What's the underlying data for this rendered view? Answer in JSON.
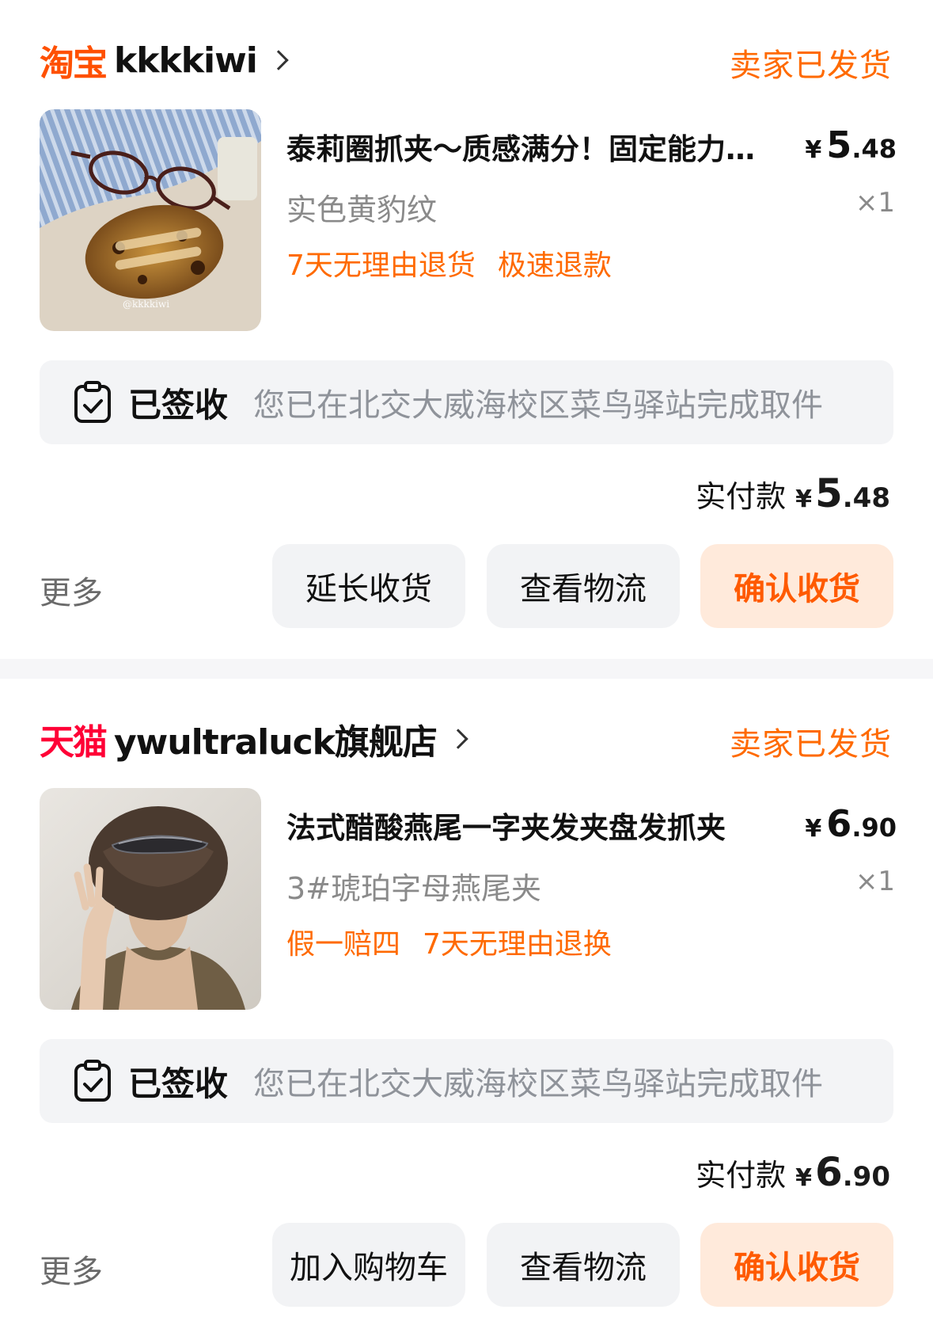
{
  "orders": [
    {
      "platform": "淘宝",
      "shop_name": "kkkkiwi",
      "status": "卖家已发货",
      "product": {
        "title": "泰莉圈抓夹～质感满分！固定能力超强",
        "price_currency": "¥",
        "price_int": "5",
        "price_dec": ".48",
        "sku": "实色黄豹纹",
        "qty": "×1",
        "tags": [
          "7天无理由退货",
          "极速退款"
        ],
        "image_watermark": "@kkkkiwi"
      },
      "logistics": {
        "state": "已签收",
        "detail": "您已在北交大威海校区菜鸟驿站完成取件"
      },
      "paid": {
        "label": "实付款",
        "currency": "¥",
        "int": "5",
        "dec": ".48"
      },
      "more_label": "更多",
      "buttons": [
        "延长收货",
        "查看物流",
        "确认收货"
      ]
    },
    {
      "platform": "天猫",
      "shop_name": "ywultraluck旗舰店",
      "status": "卖家已发货",
      "product": {
        "title": "法式醋酸燕尾一字夹发夹盘发抓夹",
        "price_currency": "¥",
        "price_int": "6",
        "price_dec": ".90",
        "sku": "3#琥珀字母燕尾夹",
        "qty": "×1",
        "tags": [
          "假一赔四",
          "7天无理由退换"
        ]
      },
      "logistics": {
        "state": "已签收",
        "detail": "您已在北交大威海校区菜鸟驿站完成取件"
      },
      "paid": {
        "label": "实付款",
        "currency": "¥",
        "int": "6",
        "dec": ".90"
      },
      "more_label": "更多",
      "buttons": [
        "加入购物车",
        "查看物流",
        "确认收货"
      ]
    }
  ],
  "colors": {
    "accent_orange": "#ff6a00",
    "taobao_orange": "#ff5000",
    "tmall_red": "#ff0036",
    "confirm_bg": "#ffeadb"
  }
}
